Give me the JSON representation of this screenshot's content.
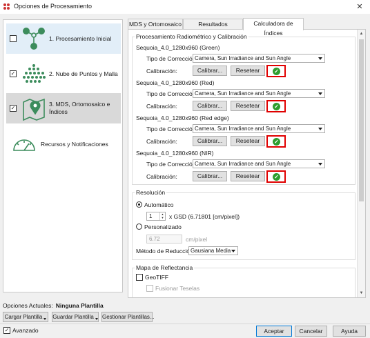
{
  "window": {
    "title": "Opciones de Procesamiento",
    "close_glyph": "✕"
  },
  "sidebar": {
    "steps": [
      {
        "label": "1. Procesamiento Inicial",
        "checked": false,
        "icon": "processing-nodes-icon"
      },
      {
        "label": "2. Nube de Puntos y Malla",
        "checked": true,
        "icon": "point-cloud-icon"
      },
      {
        "label": "3. MDS, Ortomosaico e Índices",
        "checked": true,
        "icon": "map-pin-icon"
      },
      {
        "label": "Recursos y Notificaciones",
        "icon": "gauge-icon"
      }
    ]
  },
  "tabs": [
    "MDS y Ortomosaico",
    "Resultados Adicionales",
    "Calculadora de Índices"
  ],
  "active_tab": 2,
  "radiometric": {
    "group_title": "Procesamiento Radiométrico y Calibración",
    "correction_label": "Tipo de Corrección:",
    "calibration_label": "Calibración:",
    "calibrate_button": "Calibrar...",
    "reset_button": "Resetear",
    "check_glyph": "✓",
    "bands": [
      {
        "name": "Sequoia_4.0_1280x960 (Green)",
        "correction": "Camera, Sun Irradiance and Sun Angle"
      },
      {
        "name": "Sequoia_4.0_1280x960 (Red)",
        "correction": "Camera, Sun Irradiance and Sun Angle"
      },
      {
        "name": "Sequoia_4.0_1280x960 (Red edge)",
        "correction": "Camera, Sun Irradiance and Sun Angle"
      },
      {
        "name": "Sequoia_4.0_1280x960 (NIR)",
        "correction": "Camera, Sun Irradiance and Sun Angle"
      }
    ]
  },
  "resolution": {
    "group_title": "Resolución",
    "auto_label": "Automático",
    "auto_selected": true,
    "gsd_value": "1",
    "gsd_suffix": "x GSD (6.71801 [cm/pixel])",
    "custom_label": "Personalizado",
    "custom_value": "6.72",
    "custom_unit": "cm/pixel",
    "reduction_label": "Método de Reducción:",
    "reduction_value": "Gausiana Media"
  },
  "reflectance": {
    "group_title": "Mapa de Reflectancia",
    "geotiff_label": "GeoTIFF",
    "geotiff_checked": false,
    "merge_label": "Fusionar Teselas",
    "merge_checked": false
  },
  "footer": {
    "current_options_label": "Opciones Actuales:",
    "current_template": "Ninguna Plantilla",
    "load_template": "Cargar Plantilla",
    "save_template": "Guardar Plantilla",
    "manage_templates": "Gestionar Plantillas...",
    "advanced_label": "Avanzado",
    "advanced_checked": true,
    "accept": "Aceptar",
    "cancel": "Cancelar",
    "help": "Ayuda"
  },
  "check_mark_glyph": "✓",
  "colors": {
    "accent_green": "#2e9d2e",
    "highlight_red": "#e00000",
    "selected_blue": "#e2eef8",
    "icon_green": "#3c8c5c"
  }
}
